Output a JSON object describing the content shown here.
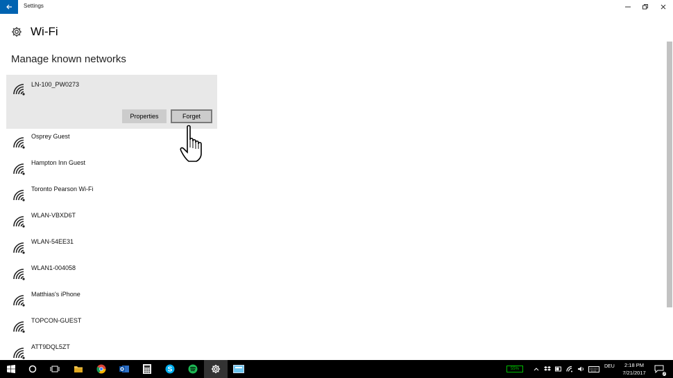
{
  "window": {
    "title": "Settings"
  },
  "header": {
    "title": "Wi-Fi"
  },
  "section": {
    "title": "Manage known networks"
  },
  "networks": [
    {
      "name": "LN-100_PW0273"
    },
    {
      "name": "Osprey Guest"
    },
    {
      "name": "Hampton Inn Guest"
    },
    {
      "name": "Toronto Pearson Wi-Fi"
    },
    {
      "name": "WLAN-VBXD6T"
    },
    {
      "name": "WLAN-54EE31"
    },
    {
      "name": "WLAN1-004058"
    },
    {
      "name": "Matthias's iPhone"
    },
    {
      "name": "TOPCON-GUEST"
    },
    {
      "name": "ATT9DQL5ZT"
    }
  ],
  "actions": {
    "properties": "Properties",
    "forget": "Forget"
  },
  "taskbar": {
    "battery": "55%",
    "language": "DEU",
    "time": "2:18 PM",
    "date": "7/21/2017",
    "notifications": "3"
  },
  "colors": {
    "accent": "#0063b1",
    "selected_bg": "#e8e8e8",
    "button_bg": "#cccccc",
    "taskbar_bg": "#000000",
    "battery_green": "#00c000"
  }
}
